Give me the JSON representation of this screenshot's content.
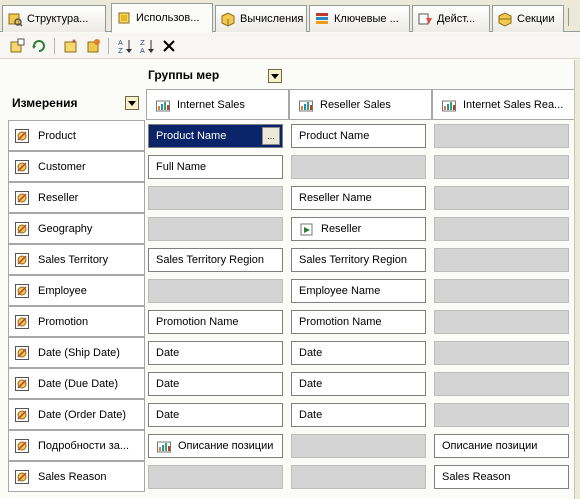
{
  "tabs": [
    {
      "label": "Структура...",
      "icon": "cube-structure-icon"
    },
    {
      "label": "Использов...",
      "icon": "dimension-usage-icon",
      "active": true
    },
    {
      "label": "Вычисления",
      "icon": "calculations-icon"
    },
    {
      "label": "Ключевые ...",
      "icon": "kpi-icon"
    },
    {
      "label": "Дейст...",
      "icon": "actions-icon"
    },
    {
      "label": "Секции",
      "icon": "partitions-icon"
    }
  ],
  "toolbar": {
    "buttons": [
      "add-cube-dimension-icon",
      "refresh-icon",
      "add-measure-group-icon",
      "add-dimension-icon",
      "sort-asc-icon",
      "sort-desc-icon",
      "delete-icon"
    ]
  },
  "grid": {
    "measure_groups_title": "Группы мер",
    "dimensions_title": "Измерения",
    "measure_groups": [
      "Internet Sales",
      "Reseller Sales",
      "Internet Sales Rea..."
    ],
    "rows": [
      {
        "dimension": "Product",
        "cells": [
          {
            "text": "Product Name",
            "selected": true
          },
          {
            "text": "Product Name"
          },
          {
            "empty": true
          }
        ]
      },
      {
        "dimension": "Customer",
        "cells": [
          {
            "text": "Full Name"
          },
          {
            "empty": true
          },
          {
            "empty": true
          }
        ]
      },
      {
        "dimension": "Reseller",
        "cells": [
          {
            "empty": true
          },
          {
            "text": "Reseller Name"
          },
          {
            "empty": true
          }
        ]
      },
      {
        "dimension": "Geography",
        "cells": [
          {
            "empty": true
          },
          {
            "text": "Reseller",
            "icon": "referenced-icon"
          },
          {
            "empty": true
          }
        ]
      },
      {
        "dimension": "Sales Territory",
        "cells": [
          {
            "text": "Sales Territory Region"
          },
          {
            "text": "Sales Territory Region"
          },
          {
            "empty": true
          }
        ]
      },
      {
        "dimension": "Employee",
        "cells": [
          {
            "empty": true
          },
          {
            "text": "Employee Name"
          },
          {
            "empty": true
          }
        ]
      },
      {
        "dimension": "Promotion",
        "cells": [
          {
            "text": "Promotion Name"
          },
          {
            "text": "Promotion Name"
          },
          {
            "empty": true
          }
        ]
      },
      {
        "dimension": "Date (Ship Date)",
        "cells": [
          {
            "text": "Date"
          },
          {
            "text": "Date"
          },
          {
            "empty": true
          }
        ]
      },
      {
        "dimension": "Date (Due Date)",
        "cells": [
          {
            "text": "Date"
          },
          {
            "text": "Date"
          },
          {
            "empty": true
          }
        ]
      },
      {
        "dimension": "Date (Order Date)",
        "cells": [
          {
            "text": "Date"
          },
          {
            "text": "Date"
          },
          {
            "empty": true
          }
        ]
      },
      {
        "dimension": "Подробности за...",
        "cells": [
          {
            "text": "Описание позиции",
            "icon": "measure-group-icon"
          },
          {
            "empty": true
          },
          {
            "text": "Описание позиции"
          }
        ]
      },
      {
        "dimension": "Sales Reason",
        "cells": [
          {
            "empty": true
          },
          {
            "empty": true
          },
          {
            "text": "Sales Reason"
          }
        ]
      }
    ],
    "ellipsis_label": "..."
  }
}
